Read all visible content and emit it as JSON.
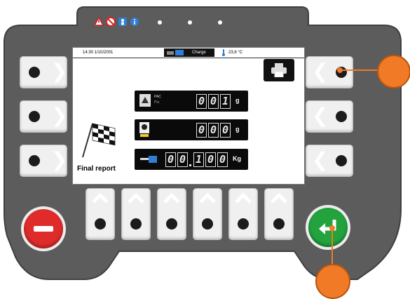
{
  "status_bar": {
    "datetime": "14:30 1/10/2001",
    "mode": "Charge",
    "temperature": "23,6 °C"
  },
  "readouts": [
    {
      "digits": [
        "0",
        "0",
        "1"
      ],
      "unit": "g",
      "label_top": "PAC",
      "label_bottom": "Pla"
    },
    {
      "digits": [
        "0",
        "0",
        "0"
      ],
      "unit": "g"
    },
    {
      "digits": [
        "0",
        "0",
        "1",
        "0",
        "0"
      ],
      "unit": "Kg",
      "decimal_after": 2
    }
  ],
  "main": {
    "report_label": "Final report"
  },
  "colors": {
    "panel": "#5c5c5c",
    "cancel_button": "#e02b2b",
    "enter_button": "#23a33d",
    "callout": "#f07a25",
    "lcd": "#0a0a0a"
  },
  "icons": {
    "top_row": [
      "warning-no-entry-icon",
      "prohibited-icon",
      "person-icon",
      "info-icon"
    ],
    "print": "printer-icon",
    "report": "checkered-flag-icon",
    "cancel": "minus-icon",
    "enter": "enter-return-icon"
  }
}
